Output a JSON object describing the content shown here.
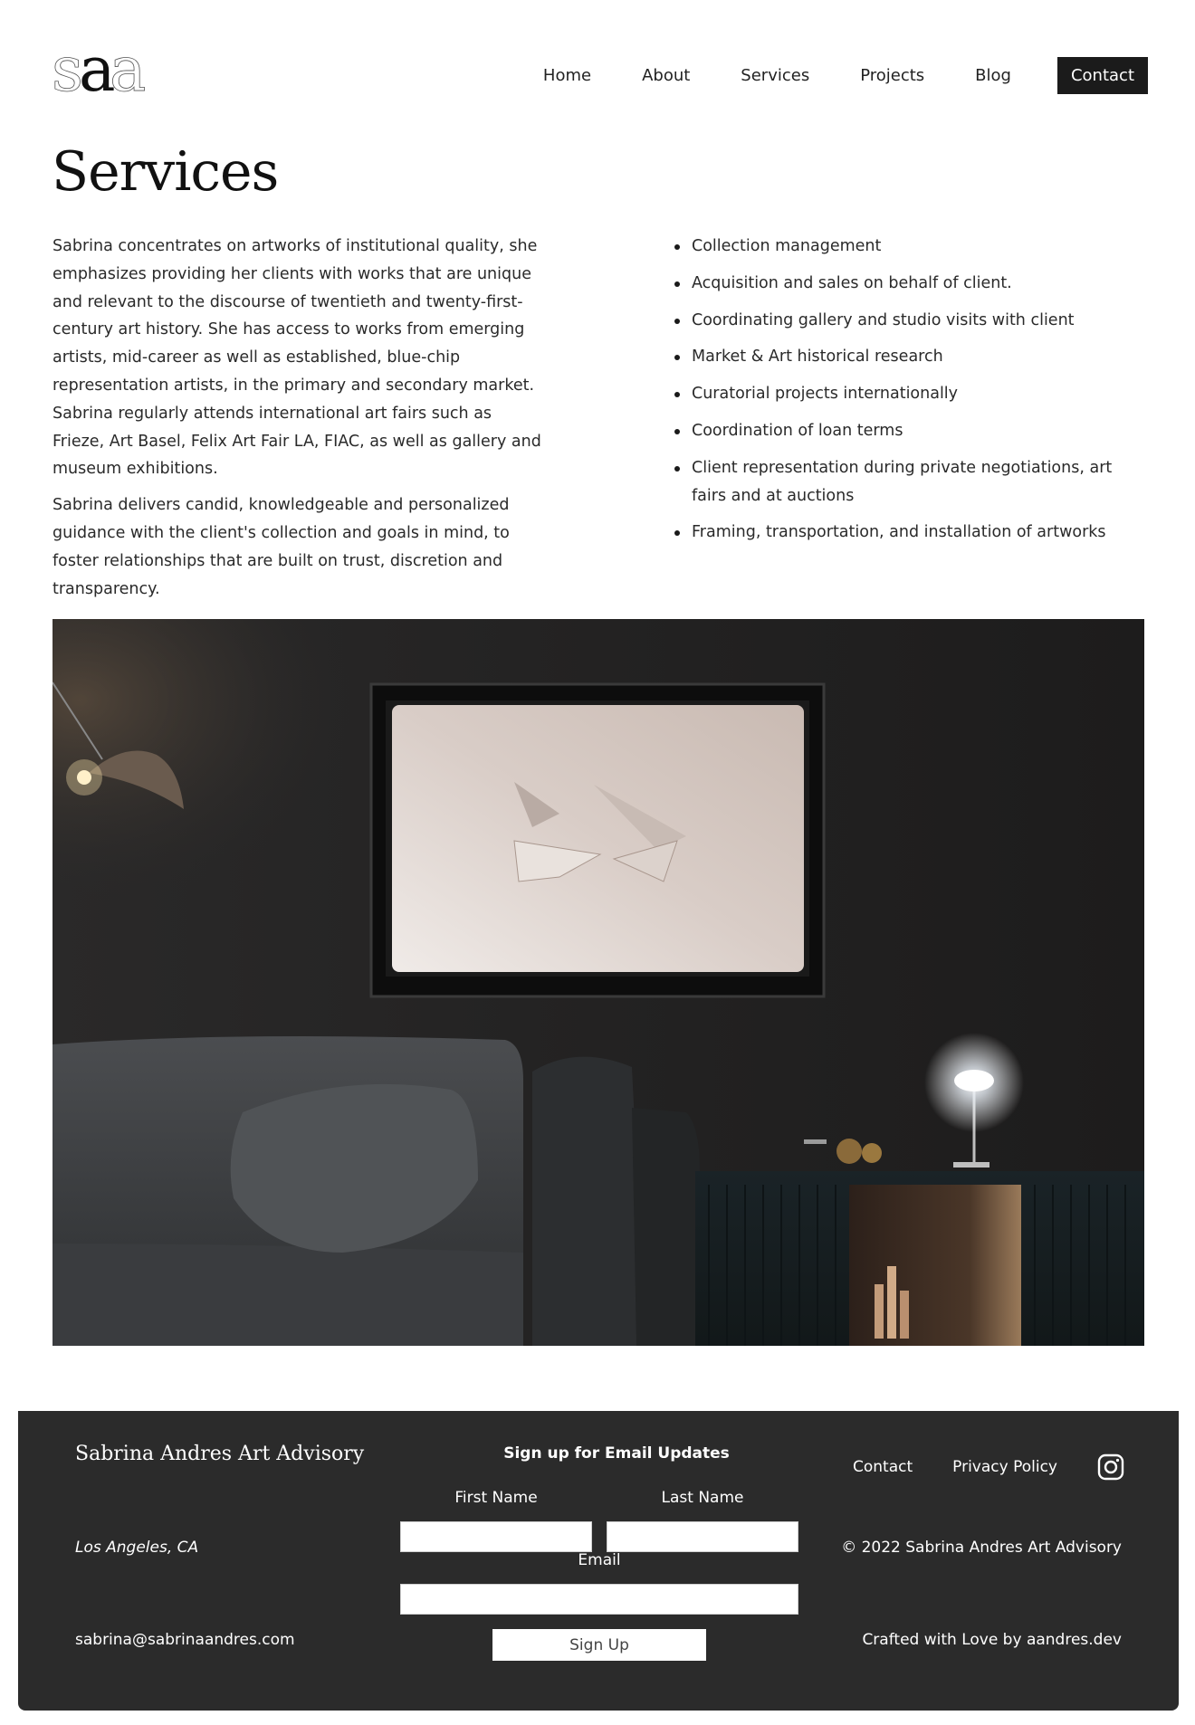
{
  "header": {
    "logo_text": "saa",
    "nav": [
      "Home",
      "About",
      "Services",
      "Projects",
      "Blog",
      "Contact"
    ]
  },
  "page_title": "Services",
  "intro": {
    "paragraphs": [
      "Sabrina concentrates on artworks of institutional quality, she emphasizes providing her clients with works that are unique and relevant to the discourse of twentieth and twenty-first-century art history. She has access to works from emerging artists, mid-career as well as established, blue-chip representation artists, in the primary and secondary market. Sabrina regularly attends international art fairs such as Frieze, Art Basel, Felix Art Fair LA, FIAC, as well as gallery and museum exhibitions.",
      "Sabrina delivers candid, knowledgeable and personalized guidance with the client's collection and goals in mind, to foster relationships that are built on trust, discretion and transparency."
    ]
  },
  "services": [
    "Collection management",
    "Acquisition and sales on behalf of client.",
    "Coordinating gallery and studio visits with client",
    "Market  & Art historical research",
    "Curatorial projects internationally",
    "Coordination of loan terms",
    "Client representation during private negotiations, art fairs and at auctions",
    "Framing, transportation, and installation of artworks"
  ],
  "hero": {
    "icon": "interior-photo"
  },
  "footer": {
    "brand": "Sabrina Andres Art Advisory",
    "location": "Los Angeles, CA",
    "email": "sabrina@sabrinaandres.com",
    "signup_title": "Sign up for Email Updates",
    "first_name_label": "First Name",
    "last_name_label": "Last Name",
    "email_label": "Email",
    "signup_button": "Sign Up",
    "links": [
      "Contact",
      "Privacy Policy"
    ],
    "social_icon": "instagram-icon",
    "copyright": "© 2022 Sabrina Andres Art Advisory",
    "crafted": "Crafted with Love by aandres.dev"
  },
  "colors": {
    "footer_bg": "#2b2b2b",
    "nav_active_bg": "#1b1b1b"
  }
}
